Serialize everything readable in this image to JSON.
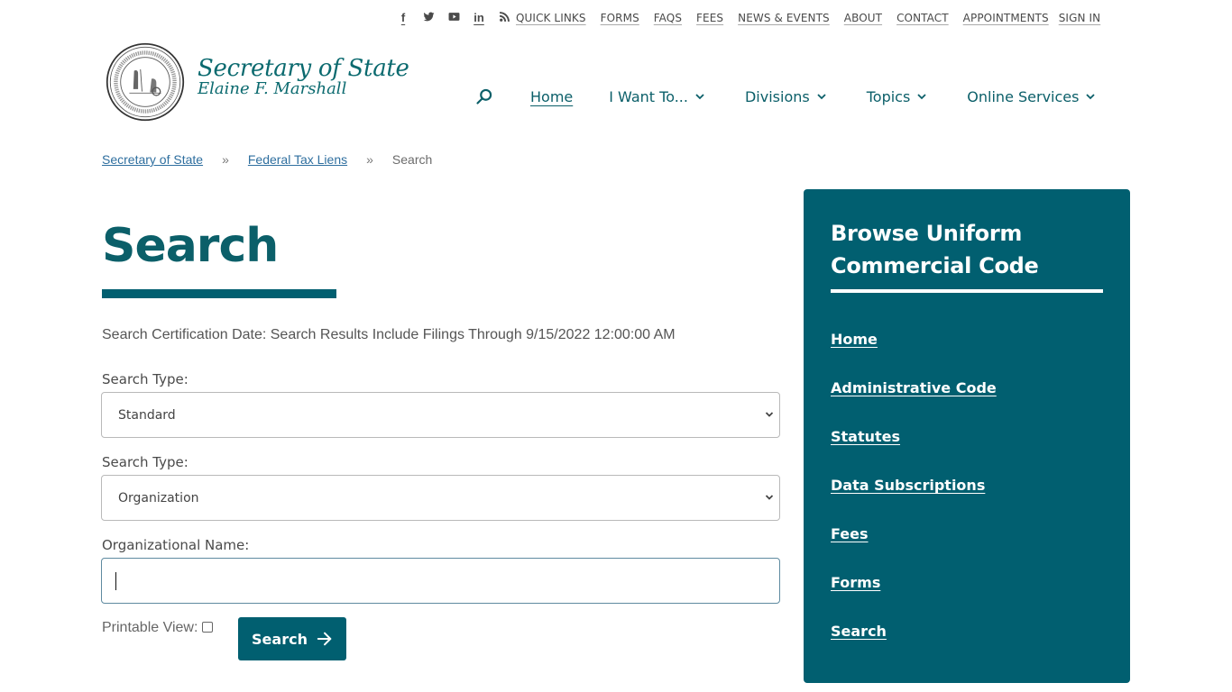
{
  "utility_nav": {
    "social": [
      {
        "name": "facebook-icon",
        "glyph": "f"
      },
      {
        "name": "twitter-icon",
        "glyph": ""
      },
      {
        "name": "youtube-icon",
        "glyph": ""
      },
      {
        "name": "linkedin-icon",
        "glyph": "in"
      },
      {
        "name": "rss-icon",
        "glyph": ""
      }
    ],
    "links": [
      "QUICK LINKS",
      "FORMS",
      "FAQS",
      "FEES",
      "NEWS & EVENTS",
      "ABOUT",
      "CONTACT",
      "APPOINTMENTS",
      "SIGN IN"
    ]
  },
  "brand": {
    "title": "Secretary of State",
    "subtitle": "Elaine F. Marshall",
    "accent_color": "#015f70"
  },
  "main_nav": {
    "items": [
      {
        "label": "Home",
        "active": true,
        "dropdown": false
      },
      {
        "label": "I Want To...",
        "active": false,
        "dropdown": true
      },
      {
        "label": "Divisions",
        "active": false,
        "dropdown": true
      },
      {
        "label": "Topics",
        "active": false,
        "dropdown": true
      },
      {
        "label": "Online Services",
        "active": false,
        "dropdown": true
      }
    ]
  },
  "breadcrumb": {
    "items": [
      "Secretary of State",
      "Federal Tax Liens"
    ],
    "separator": "»",
    "current": "Search"
  },
  "page": {
    "title": "Search",
    "certification": "Search Certification Date: Search Results Include Filings Through 9/15/2022 12:00:00 AM"
  },
  "form": {
    "search_type_1": {
      "label": "Search Type:",
      "value": "Standard"
    },
    "search_type_2": {
      "label": "Search Type:",
      "value": "Organization"
    },
    "org_name": {
      "label": "Organizational Name:",
      "value": ""
    },
    "printable_view": {
      "label": "Printable View:",
      "checked": false
    },
    "submit_label": "Search"
  },
  "sidebar": {
    "heading_line1": "Browse Uniform",
    "heading_line2": "Commercial Code",
    "links": [
      "Home",
      "Administrative Code",
      "Statutes",
      "Data Subscriptions",
      "Fees",
      "Forms",
      "Search"
    ]
  }
}
